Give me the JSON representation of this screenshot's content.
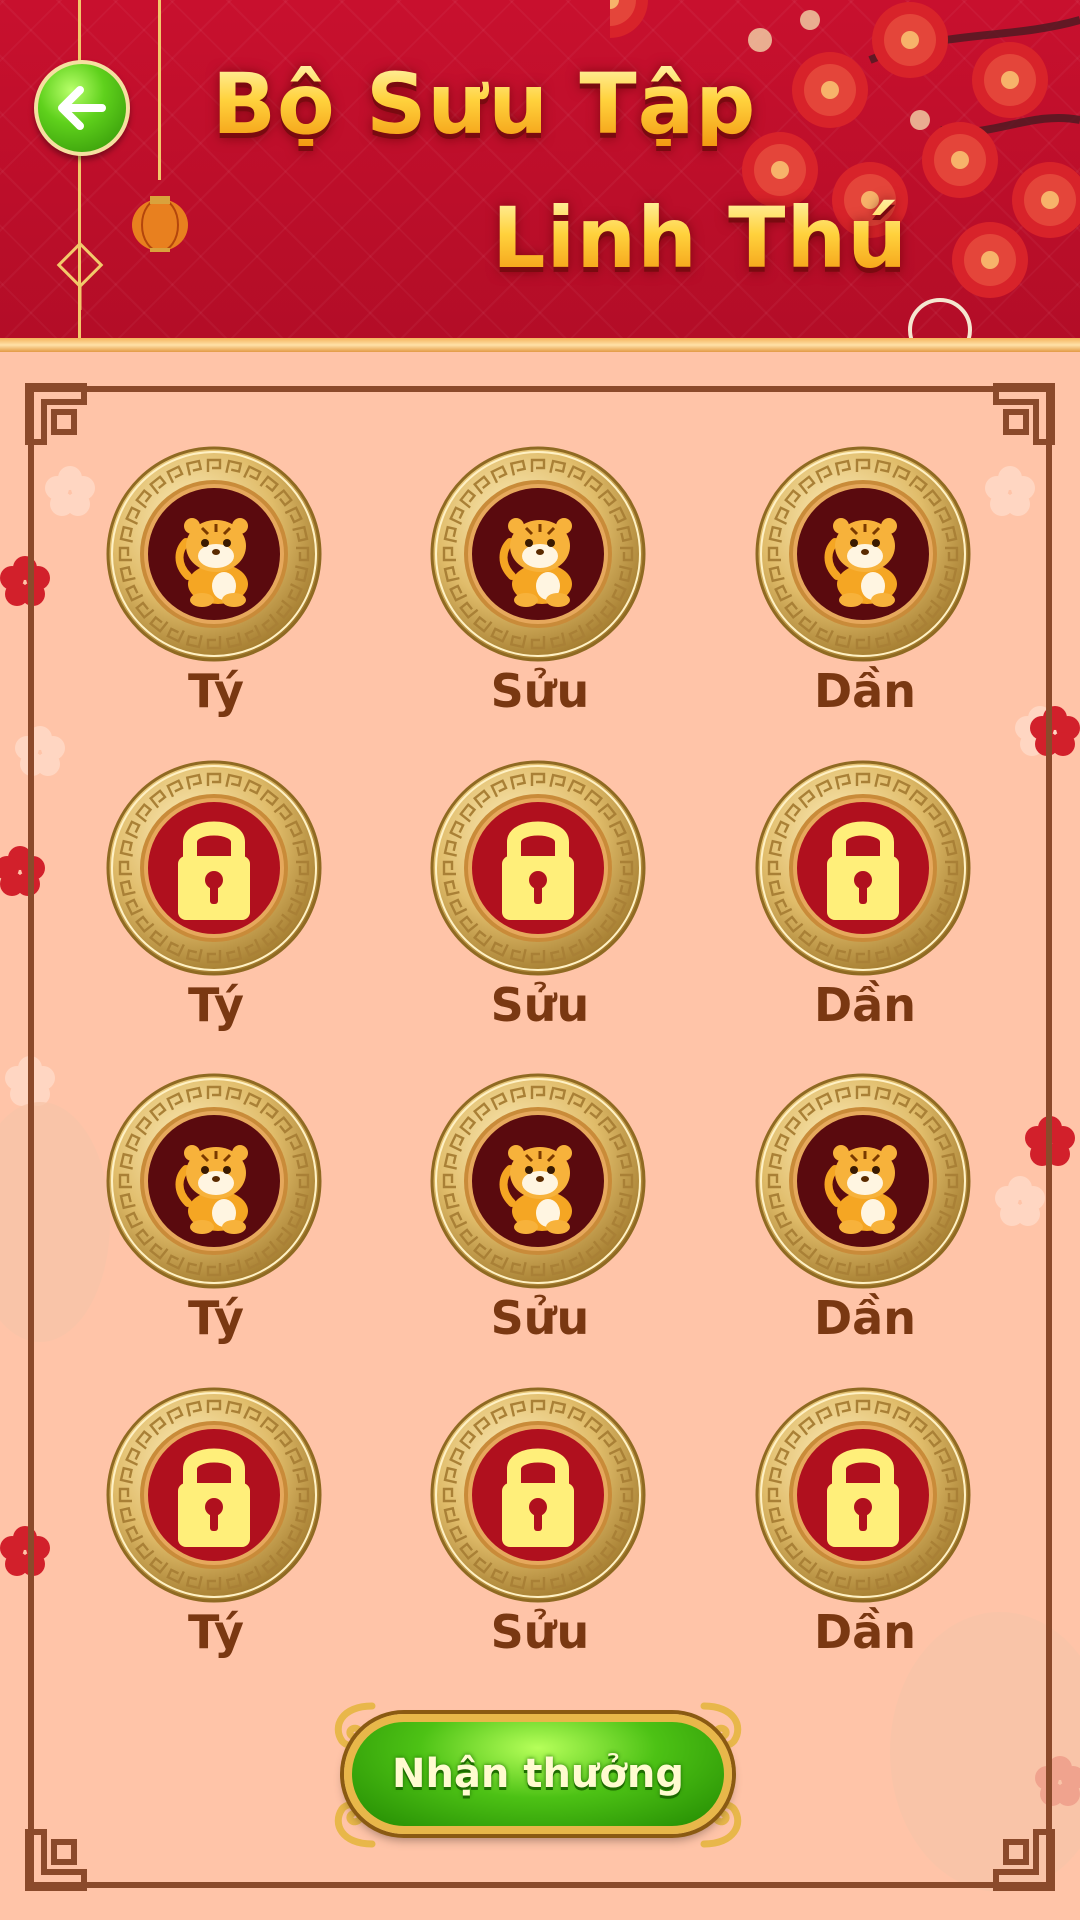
{
  "header": {
    "title_line1": "Bộ Sưu Tập",
    "title_line2": "Linh Thú",
    "back_icon": "arrow-left-icon"
  },
  "collection": {
    "rows": [
      [
        {
          "label": "Tý",
          "state": "unlocked",
          "icon": "tiger-icon"
        },
        {
          "label": "Sửu",
          "state": "unlocked",
          "icon": "tiger-icon"
        },
        {
          "label": "Dần",
          "state": "unlocked",
          "icon": "tiger-icon"
        }
      ],
      [
        {
          "label": "Tý",
          "state": "locked",
          "icon": "lock-icon"
        },
        {
          "label": "Sửu",
          "state": "locked",
          "icon": "lock-icon"
        },
        {
          "label": "Dần",
          "state": "locked",
          "icon": "lock-icon"
        }
      ],
      [
        {
          "label": "Tý",
          "state": "unlocked",
          "icon": "tiger-icon"
        },
        {
          "label": "Sửu",
          "state": "unlocked",
          "icon": "tiger-icon"
        },
        {
          "label": "Dần",
          "state": "unlocked",
          "icon": "tiger-icon"
        }
      ],
      [
        {
          "label": "Tý",
          "state": "locked",
          "icon": "lock-icon"
        },
        {
          "label": "Sửu",
          "state": "locked",
          "icon": "lock-icon"
        },
        {
          "label": "Dần",
          "state": "locked",
          "icon": "lock-icon"
        }
      ]
    ]
  },
  "reward_button": {
    "label": "Nhận thưởng"
  },
  "colors": {
    "header_red": "#c8102e",
    "background_peach": "#ffc4a8",
    "frame_brown": "#8b4a2b",
    "label_brown": "#7a3812",
    "title_gold": "#ffd23d",
    "button_green": "#4dc215",
    "locked_red": "#b0101e",
    "unlocked_dark": "#5a0a0e",
    "lock_yellow": "#ffef7a"
  }
}
